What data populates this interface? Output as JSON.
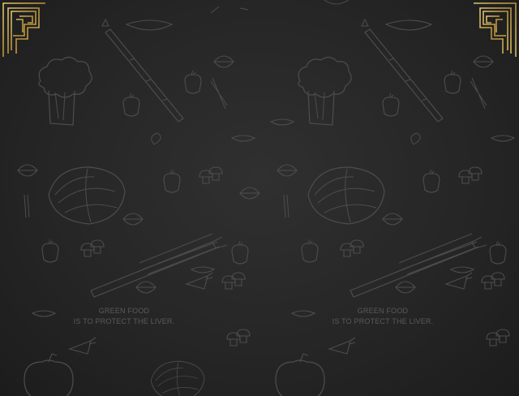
{
  "poster": {
    "background_color": "#262626",
    "frame_color": "#c9a84a",
    "doodle_color": "#4a4a4a",
    "pattern_icons": [
      "broccoli-icon",
      "cabbage-icon",
      "asparagus-icon",
      "pepper-icon",
      "leaf-icon",
      "garlic-icon",
      "carrot-icon",
      "zucchini-icon"
    ],
    "taglines": [
      {
        "line1": "GREEN FOOD",
        "line2": "IS TO PROTECT THE LIVER."
      },
      {
        "line1": "GREEN FOOD",
        "line2": "IS TO PROTECT THE LIVER."
      }
    ]
  }
}
